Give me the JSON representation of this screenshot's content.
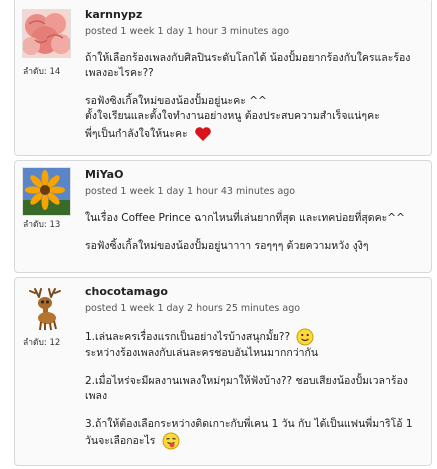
{
  "comments": [
    {
      "username": "karnnypz",
      "posted": "posted 1 week 1 day 1 hour 3 minutes ago",
      "rank": "ลำดับ: 14",
      "lines": [
        "ถ้าให้เลือกร้องเพลงกับศิลปินระดับโลกได้ น้องปั้มอยากร้องกับใครและร้องเพลงอะไรคะ??",
        "รอฟังซิงเกิ้ลใหม่ของน้องปั้มอยู่นะคะ ^^",
        "ตั้งใจเรียนและตั้งใจทำงานอย่างหนู ต้องประสบความสำเร็จแน่ๆคะ",
        "พี่ๆเป็นกำลังใจให้นะคะ"
      ]
    },
    {
      "username": "MiYaO",
      "posted": "posted 1 week 1 day 1 hour 43 minutes ago",
      "rank": "ลำดับ: 13",
      "lines": [
        "ในเรื่อง Coffee Prince ฉากไหนที่เล่นยากที่สุด และเทคบ่อยที่สุดคะ^^",
        "รอฟังซิ้งเกิ้ลใหม่ของน้องปั้มอยู่นาาาา รอๆๆๆ ด้วยความหวัง งุงิๆ"
      ]
    },
    {
      "username": "chocotamago",
      "posted": "posted 1 week 1 day 2 hours 25 minutes ago",
      "rank": "ลำดับ: 12",
      "lines": [
        "1.เล่นละครเรื่องแรกเป็นอย่างไรบ้างสนุกมั้ย??",
        "ระหว่างร้องเพลงกับเล่นละครชอบอันไหนมากกว่ากัน",
        "2.เมื่อไหร่จะมีผลงานเพลงใหม่ๆมาให้ฟังบ้าง?? ชอบเสียงน้องปั้มเวลาร้องเพลง",
        "3.ถ้าให้ต้องเลือกระหว่างติดเกาะกับพี่เคน 1 วัน กับ ได้เป็นแฟนพี่มาริโอ้ 1 วันจะเลือกอะไร"
      ]
    }
  ]
}
